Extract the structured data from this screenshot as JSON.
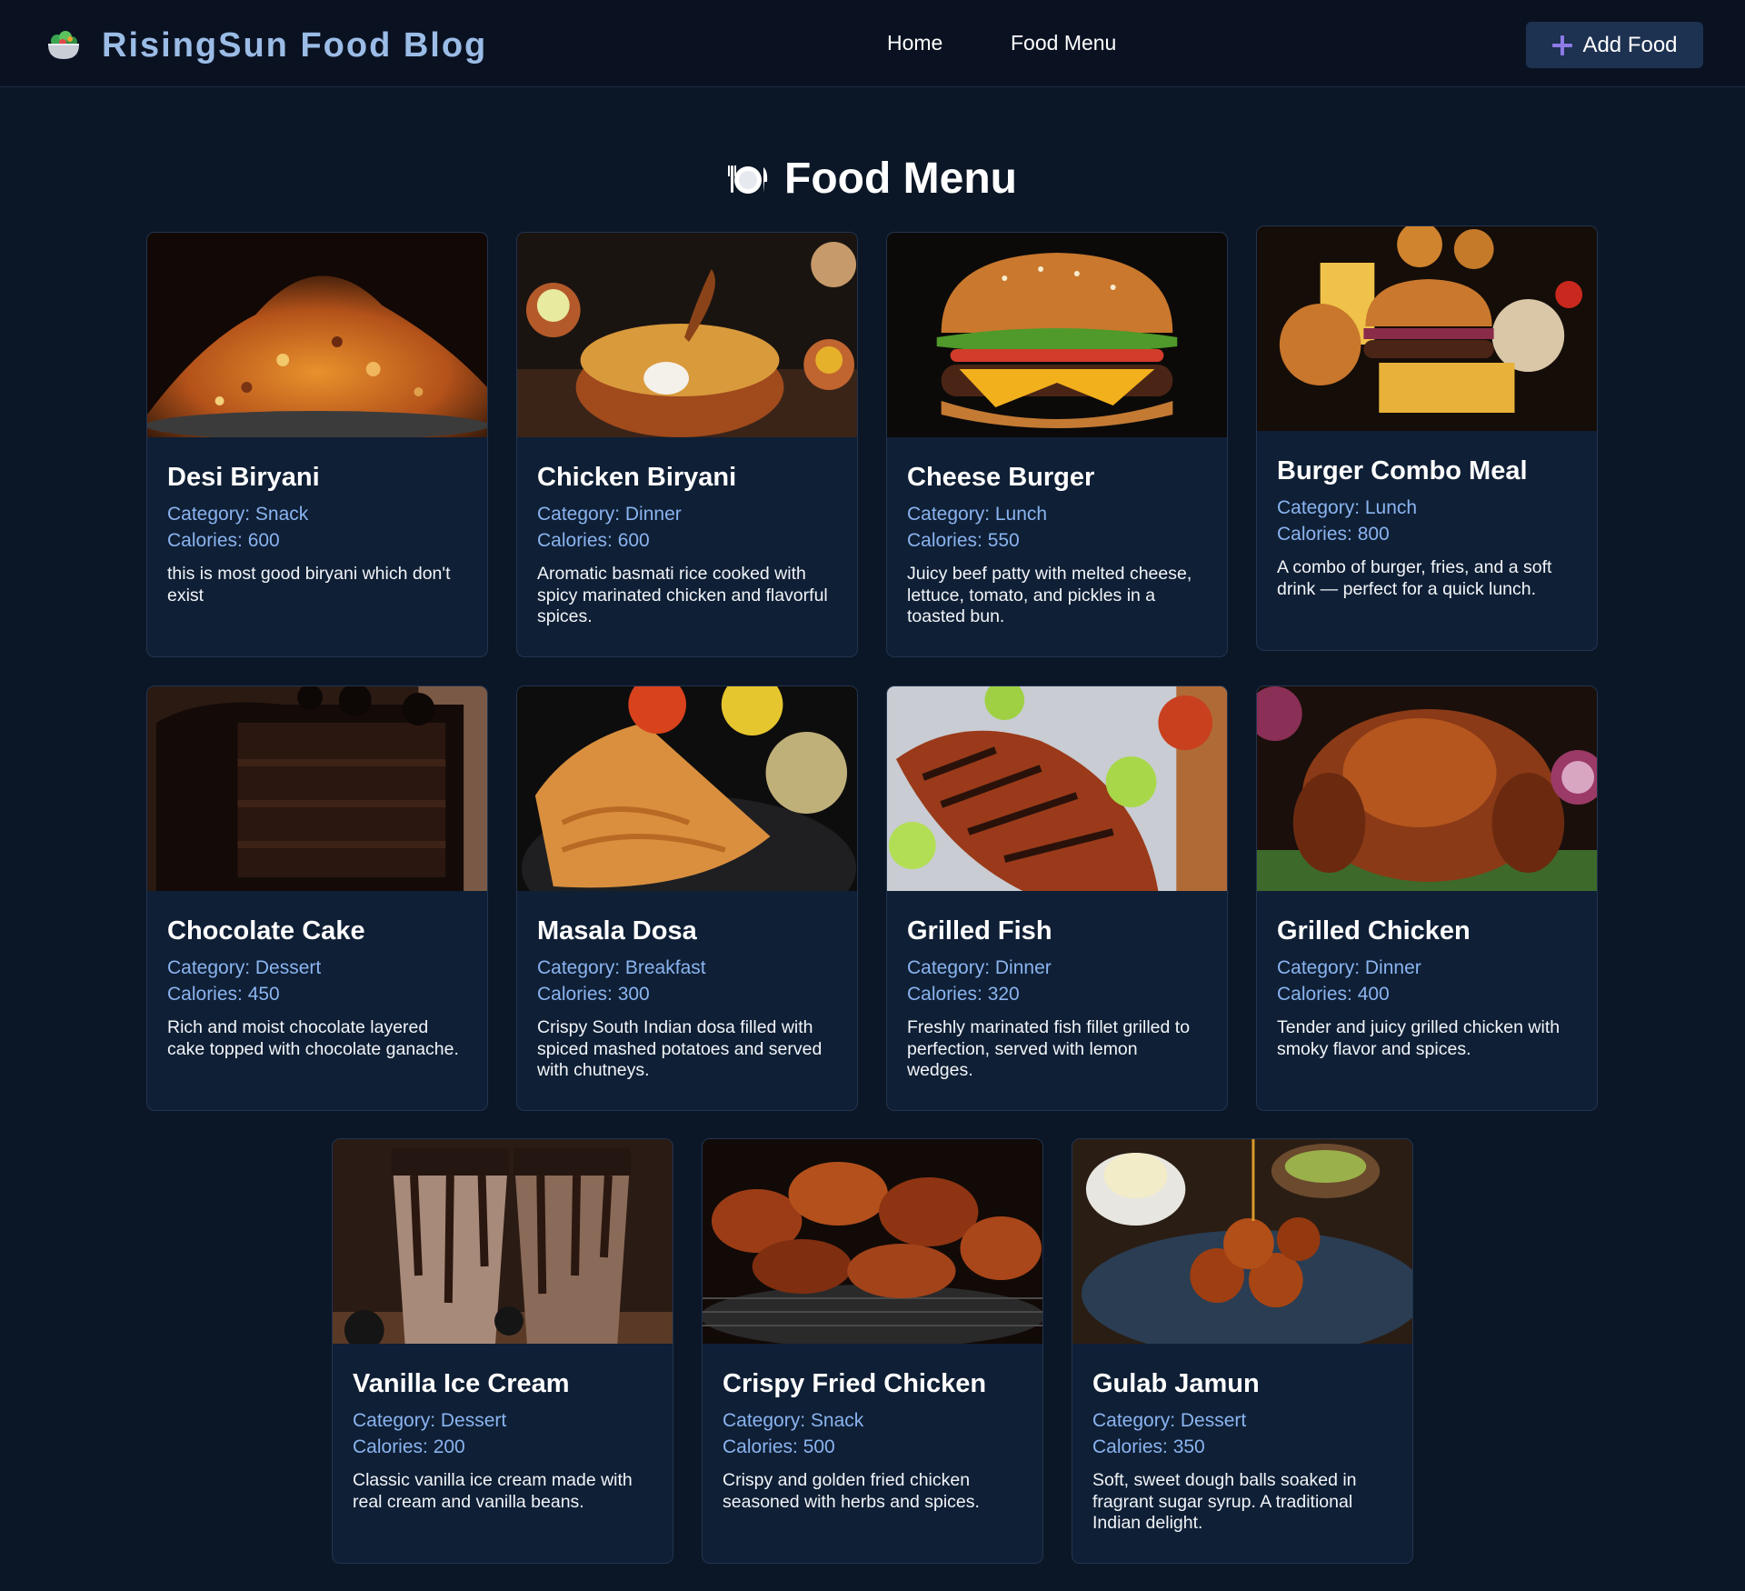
{
  "header": {
    "brand": "RisingSun Food Blog",
    "brand_icon": "salad-bowl-icon",
    "nav": [
      "Home",
      "Food Menu"
    ],
    "add_button": "Add Food",
    "add_icon": "plus-icon"
  },
  "page": {
    "title": "Food Menu",
    "title_icon": "plate-cutlery-icon"
  },
  "colors": {
    "background": "#0b1727",
    "navbar": "#0a1222",
    "card": "#0f1f35",
    "accent_text": "#8ab4f0",
    "brand_text": "#9bbce6",
    "button": "#1d3150"
  },
  "foods": [
    {
      "name": "Desi Biryani",
      "category": "Category: Snack",
      "calories": "Calories: 600",
      "description": "this is most good biryani which don't exist",
      "image": "biryani-plate-photo"
    },
    {
      "name": "Chicken Biryani",
      "category": "Category: Dinner",
      "calories": "Calories: 600",
      "description": "Aromatic basmati rice cooked with spicy marinated chicken and flavorful spices.",
      "image": "chicken-biryani-pot-photo"
    },
    {
      "name": "Cheese Burger",
      "category": "Category: Lunch",
      "calories": "Calories: 550",
      "description": "Juicy beef patty with melted cheese, lettuce, tomato, and pickles in a toasted bun.",
      "image": "cheese-burger-photo"
    },
    {
      "name": "Burger Combo Meal",
      "category": "Category: Lunch",
      "calories": "Calories: 800",
      "description": "A combo of burger, fries, and a soft drink — perfect for a quick lunch.",
      "image": "burger-combo-photo"
    },
    {
      "name": "Chocolate Cake",
      "category": "Category: Dessert",
      "calories": "Calories: 450",
      "description": "Rich and moist chocolate layered cake topped with chocolate ganache.",
      "image": "chocolate-cake-photo"
    },
    {
      "name": "Masala Dosa",
      "category": "Category: Breakfast",
      "calories": "Calories: 300",
      "description": "Crispy South Indian dosa filled with spiced mashed potatoes and served with chutneys.",
      "image": "masala-dosa-photo"
    },
    {
      "name": "Grilled Fish",
      "category": "Category: Dinner",
      "calories": "Calories: 320",
      "description": "Freshly marinated fish fillet grilled to perfection, served with lemon wedges.",
      "image": "grilled-fish-photo"
    },
    {
      "name": "Grilled Chicken",
      "category": "Category: Dinner",
      "calories": "Calories: 400",
      "description": "Tender and juicy grilled chicken with smoky flavor and spices.",
      "image": "grilled-chicken-photo"
    },
    {
      "name": "Vanilla Ice Cream",
      "category": "Category: Dessert",
      "calories": "Calories: 200",
      "description": "Classic vanilla ice cream made with real cream and vanilla beans.",
      "image": "milkshake-glasses-photo"
    },
    {
      "name": "Crispy Fried Chicken",
      "category": "Category: Snack",
      "calories": "Calories: 500",
      "description": "Crispy and golden fried chicken seasoned with herbs and spices.",
      "image": "fried-chicken-wings-photo"
    },
    {
      "name": "Gulab Jamun",
      "category": "Category: Dessert",
      "calories": "Calories: 350",
      "description": "Soft, sweet dough balls soaked in fragrant sugar syrup. A traditional Indian delight.",
      "image": "gulab-jamun-photo"
    }
  ]
}
